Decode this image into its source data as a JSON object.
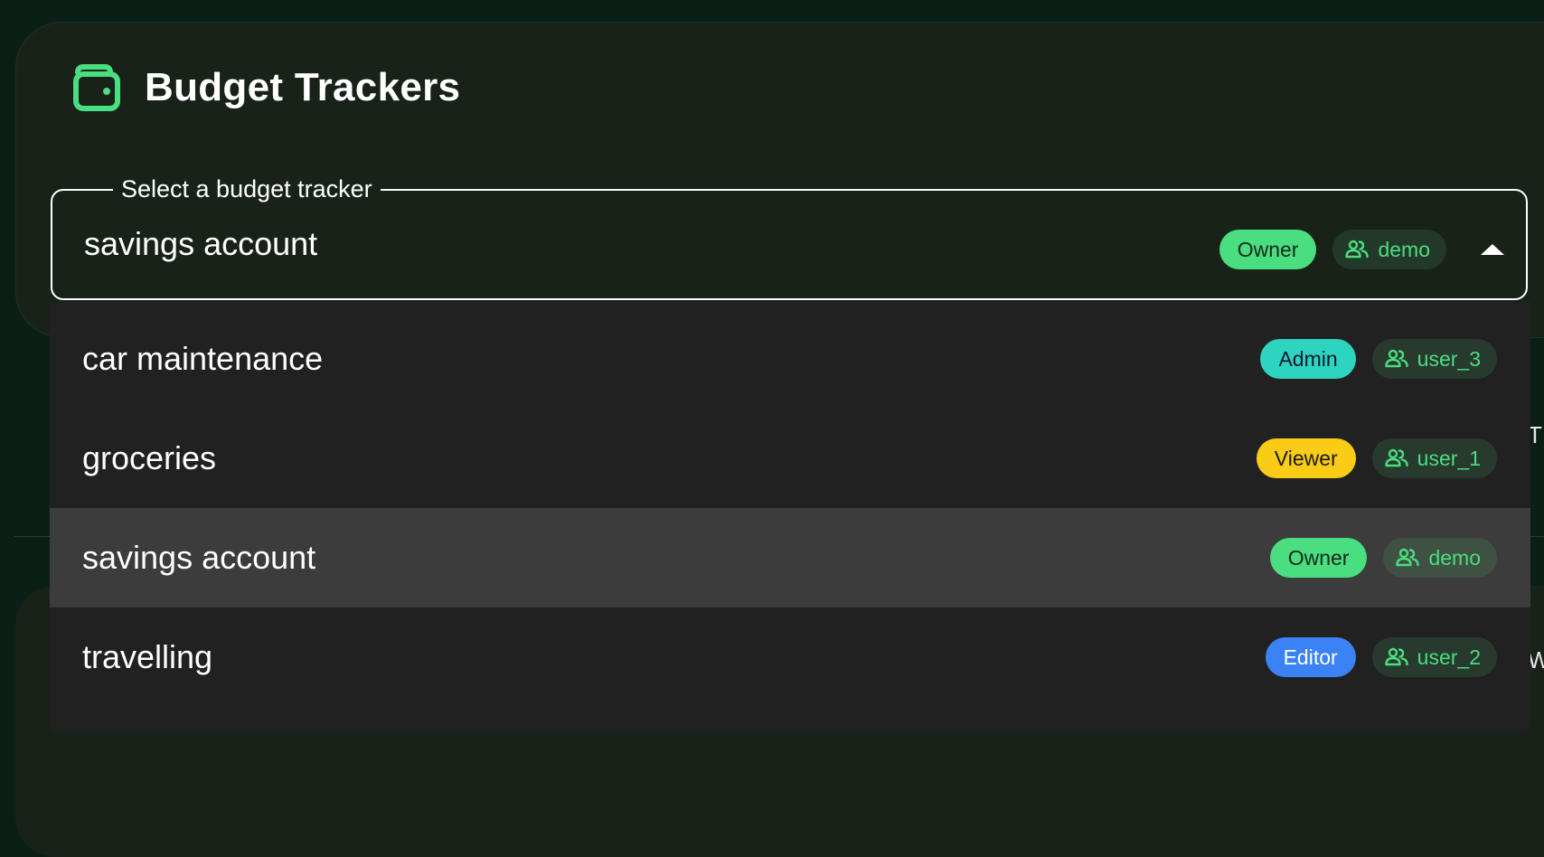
{
  "header": {
    "title": "Budget Trackers",
    "icon": "wallet-icon",
    "accent_color": "#4ade80"
  },
  "select": {
    "legend": "Select a budget tracker",
    "value": "savings account",
    "role": "Owner",
    "owner": "demo",
    "expanded": true
  },
  "options": [
    {
      "label": "car maintenance",
      "role": "Admin",
      "role_color": "#2dd4bf",
      "role_text_color": "#0f172a",
      "owner": "user_3",
      "selected": false
    },
    {
      "label": "groceries",
      "role": "Viewer",
      "role_color": "#facc15",
      "role_text_color": "#1a1a1a",
      "owner": "user_1",
      "selected": false
    },
    {
      "label": "savings account",
      "role": "Owner",
      "role_color": "#4ade80",
      "role_text_color": "#0f2a18",
      "owner": "demo",
      "selected": true
    },
    {
      "label": "travelling",
      "role": "Editor",
      "role_color": "#3b82f6",
      "role_text_color": "#ffffff",
      "owner": "user_2",
      "selected": false
    }
  ],
  "background_fragments": {
    "right_t": "T",
    "right_w": "W"
  }
}
